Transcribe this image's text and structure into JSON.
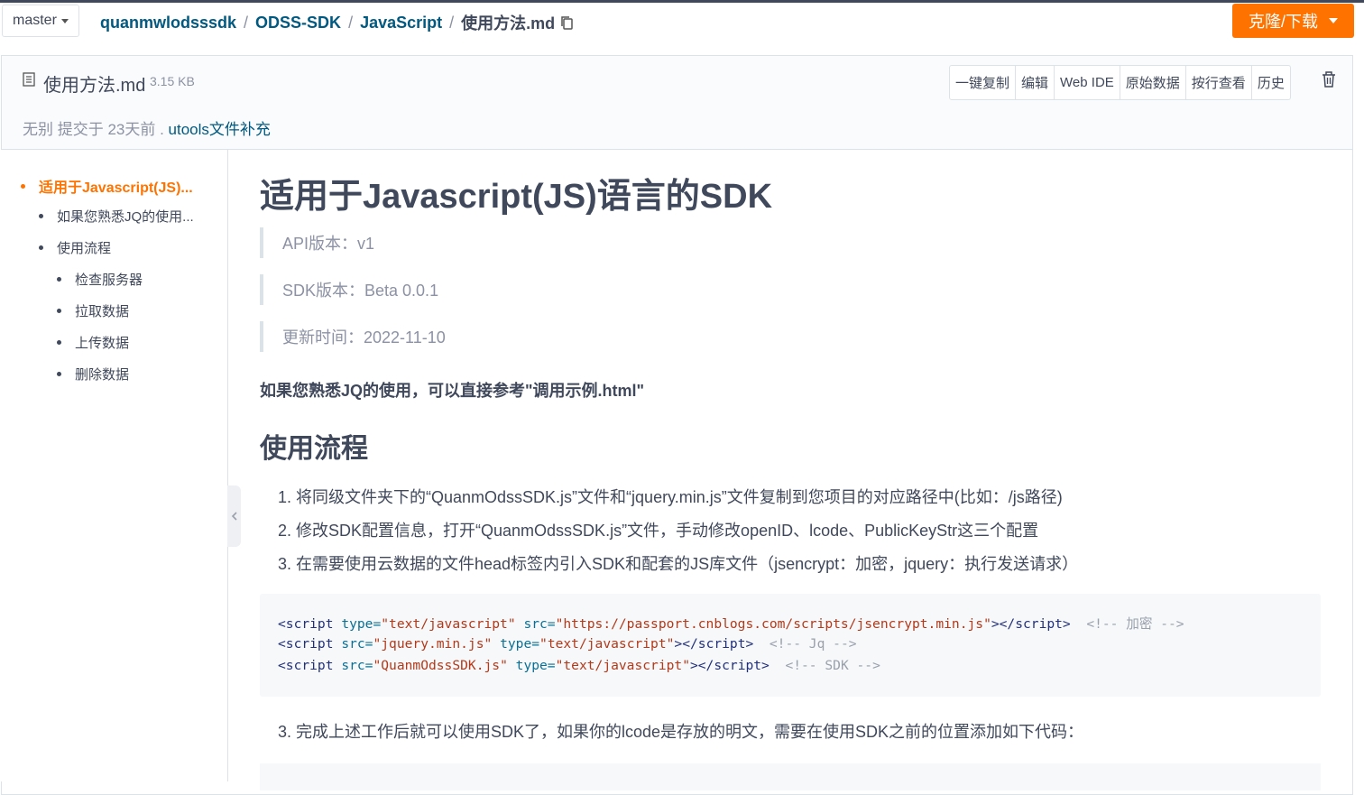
{
  "header": {
    "branch": "master",
    "breadcrumbs": [
      "quanmwlodsssdk",
      "ODSS-SDK",
      "JavaScript"
    ],
    "current_file": "使用方法.md",
    "clone_label": "克隆/下载"
  },
  "file": {
    "name": "使用方法.md",
    "size": "3.15 KB",
    "commit_prefix": "无别 提交于 23天前 .",
    "commit_message": "utools文件补充",
    "actions": [
      "一键复制",
      "编辑",
      "Web IDE",
      "原始数据",
      "按行查看",
      "历史"
    ]
  },
  "toc": [
    {
      "label": "适用于Javascript(JS)...",
      "level": 1,
      "active": true
    },
    {
      "label": "如果您熟悉JQ的使用...",
      "level": 2
    },
    {
      "label": "使用流程",
      "level": 2
    },
    {
      "label": "检查服务器",
      "level": 3
    },
    {
      "label": "拉取数据",
      "level": 3
    },
    {
      "label": "上传数据",
      "level": 3
    },
    {
      "label": "删除数据",
      "level": 3
    }
  ],
  "doc": {
    "title": "适用于Javascript(JS)语言的SDK",
    "meta": [
      "API版本：v1",
      "SDK版本：Beta 0.0.1",
      "更新时间：2022-11-10"
    ],
    "jq_note": "如果您熟悉JQ的使用，可以直接参考\"调用示例.html\"",
    "section_title": "使用流程",
    "steps": [
      "1. 将同级文件夹下的“QuanmOdssSDK.js”文件和“jquery.min.js”文件复制到您项目的对应路径中(比如：/js路径)",
      "2. 修改SDK配置信息，打开“QuanmOdssSDK.js”文件，手动修改openID、lcode、PublicKeyStr这三个配置",
      "3. 在需要使用云数据的文件head标签内引入SDK和配套的JS库文件（jsencrypt：加密，jquery：执行发送请求）"
    ],
    "code": [
      {
        "src": "https://passport.cnblogs.com/scripts/jsencrypt.min.js",
        "type": "text/javascript",
        "comment": "<!-- 加密 -->"
      },
      {
        "src": "jquery.min.js",
        "type": "text/javascript",
        "comment": "<!-- Jq -->"
      },
      {
        "src": "QuanmOdssSDK.js",
        "type": "text/javascript",
        "comment": "<!-- SDK -->"
      }
    ],
    "step_after": "3. 完成上述工作后就可以使用SDK了，如果你的lcode是存放的明文，需要在使用SDK之前的位置添加如下代码："
  },
  "colors": {
    "accent": "#fe7300",
    "link": "#005980",
    "text": "#40485b",
    "muted": "#8c92a4"
  }
}
